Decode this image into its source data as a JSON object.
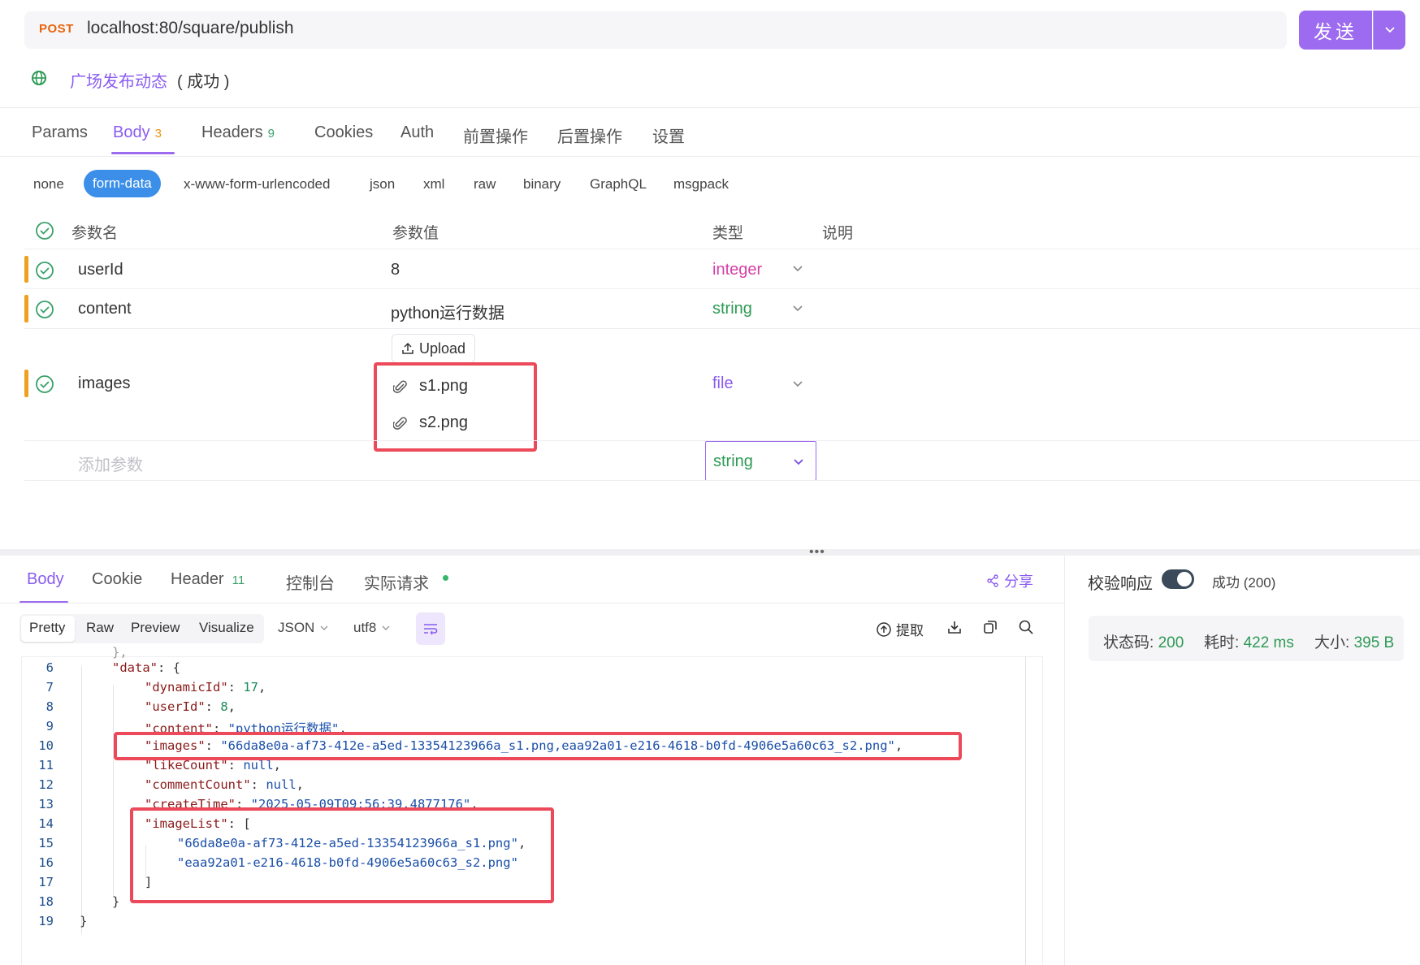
{
  "request": {
    "method": "POST",
    "url": "localhost:80/square/publish",
    "send_label": "发送"
  },
  "api": {
    "name": "广场发布动态",
    "status": "( 成功 )"
  },
  "request_tabs": [
    {
      "label": "Params"
    },
    {
      "label": "Body",
      "count": "3"
    },
    {
      "label": "Headers",
      "count": "9"
    },
    {
      "label": "Cookies"
    },
    {
      "label": "Auth"
    },
    {
      "label": "前置操作"
    },
    {
      "label": "后置操作"
    },
    {
      "label": "设置"
    }
  ],
  "body_types": [
    "none",
    "form-data",
    "x-www-form-urlencoded",
    "json",
    "xml",
    "raw",
    "binary",
    "GraphQL",
    "msgpack"
  ],
  "params_table": {
    "headers": [
      "参数名",
      "参数值",
      "类型",
      "说明"
    ],
    "rows": [
      {
        "name": "userId",
        "value": "8",
        "type": "integer"
      },
      {
        "name": "content",
        "value": "python运行数据",
        "type": "string"
      },
      {
        "name": "images",
        "upload_label": "Upload",
        "files": [
          "s1.png",
          "s2.png"
        ],
        "type": "file"
      }
    ],
    "add_placeholder": "添加参数",
    "new_type": "string"
  },
  "response_tabs": [
    {
      "label": "Body"
    },
    {
      "label": "Cookie"
    },
    {
      "label": "Header",
      "count": "11"
    },
    {
      "label": "控制台"
    },
    {
      "label": "实际请求"
    }
  ],
  "share_label": "分享",
  "view_modes": [
    "Pretty",
    "Raw",
    "Preview",
    "Visualize"
  ],
  "format": "JSON",
  "encoding": "utf8",
  "extract_label": "提取",
  "code_lines": [
    {
      "n": "6",
      "text": "\"data\": {"
    },
    {
      "n": "7",
      "text": "\"dynamicId\": 17,"
    },
    {
      "n": "8",
      "text": "\"userId\": 8,"
    },
    {
      "n": "9",
      "text": "\"content\": \"python运行数据\","
    },
    {
      "n": "10",
      "text": "\"images\": \"66da8e0a-af73-412e-a5ed-13354123966a_s1.png,eaa92a01-e216-4618-b0fd-4906e5a60c63_s2.png\","
    },
    {
      "n": "11",
      "text": "\"likeCount\": null,"
    },
    {
      "n": "12",
      "text": "\"commentCount\": null,"
    },
    {
      "n": "13",
      "text": "\"createTime\": \"2025-05-09T09:56:39.4877176\","
    },
    {
      "n": "14",
      "text": "\"imageList\": ["
    },
    {
      "n": "15",
      "text": "\"66da8e0a-af73-412e-a5ed-13354123966a_s1.png\","
    },
    {
      "n": "16",
      "text": "\"eaa92a01-e216-4618-b0fd-4906e5a60c63_s2.png\""
    },
    {
      "n": "17",
      "text": "]"
    },
    {
      "n": "18",
      "text": "}"
    },
    {
      "n": "19",
      "text": "}"
    }
  ],
  "validation": {
    "label": "校验响应",
    "result": "成功 (200)"
  },
  "stats": {
    "status_label": "状态码:",
    "status_value": "200",
    "time_label": "耗时:",
    "time_value": "422 ms",
    "size_label": "大小:",
    "size_value": "395 B"
  },
  "colors": {
    "accent": "#9c6bf0",
    "method": "#e8640c",
    "highlight_box": "#ec4a5a",
    "success": "#2e9a55"
  }
}
